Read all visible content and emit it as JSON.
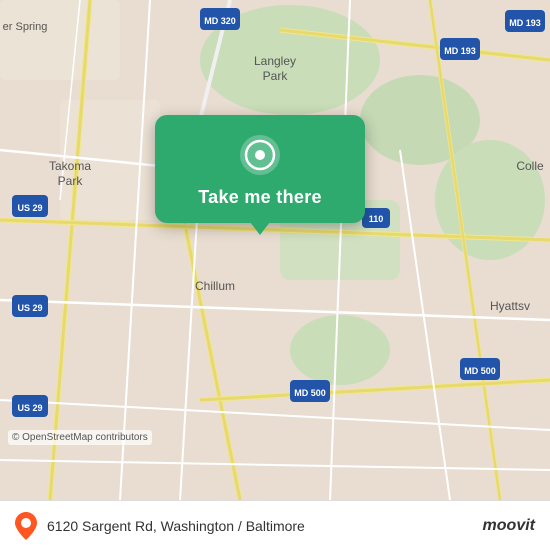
{
  "map": {
    "attribution": "© OpenStreetMap contributors",
    "background_color": "#e8ddd0"
  },
  "popup": {
    "button_label": "Take me there",
    "pin_color": "#2eaa6e"
  },
  "footer": {
    "address": "6120 Sargent Rd, Washington / Baltimore",
    "logo_text": "moovit"
  },
  "labels": {
    "takoma_park": "Takoma\nPark",
    "langley_park": "Langley\nPark",
    "chillum": "Chillum",
    "college": "Colle",
    "hyattsville": "Hyattsv",
    "silver_spring": "er Spring",
    "road_labels": [
      "US 29",
      "US 29",
      "US 29",
      "MD 193",
      "MD 193",
      "MD 320",
      "MD 500",
      "MD 500",
      "110"
    ]
  }
}
